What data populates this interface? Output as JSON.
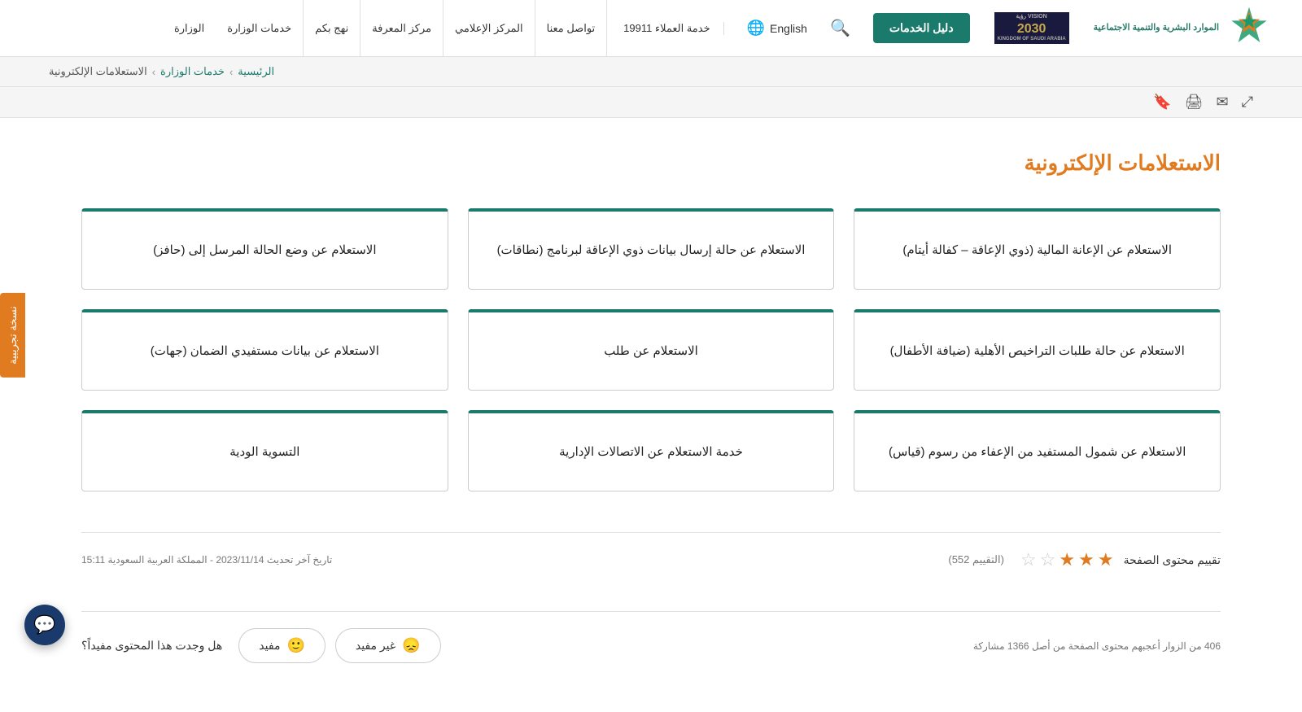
{
  "header": {
    "logo_text": "الموارد البشرية\nوالتنمية الاجتماعية",
    "services_btn_label": "دليل الخدمات",
    "lang_label": "English",
    "customer_service_label": "خدمة العملاء 19911",
    "nav_items": [
      {
        "label": "تواصل معنا"
      },
      {
        "label": "المركز الإعلامي"
      },
      {
        "label": "مركز المعرفة"
      },
      {
        "label": "نهج بكم"
      },
      {
        "label": "خدمات الوزارة"
      },
      {
        "label": "الوزارة"
      }
    ]
  },
  "breadcrumb": {
    "items": [
      {
        "label": "الرئيسية"
      },
      {
        "label": "خدمات الوزارة"
      },
      {
        "label": "الاستعلامات الإلكترونية"
      }
    ]
  },
  "toolbar": {
    "icons": [
      "share",
      "email",
      "print",
      "bookmark"
    ]
  },
  "side_tab": {
    "label": "نسخة تجريبية"
  },
  "page": {
    "title": "الاستعلامات الإلكترونية"
  },
  "cards": [
    {
      "text": "الاستعلام عن الإعانة المالية (ذوي الإعاقة – كفالة أيتام)"
    },
    {
      "text": "الاستعلام عن حالة إرسال بيانات ذوي الإعاقة لبرنامج (نطاقات)"
    },
    {
      "text": "الاستعلام عن وضع الحالة المرسل إلى (حافز)"
    },
    {
      "text": "الاستعلام عن حالة طلبات التراخيص الأهلية (ضيافة الأطفال)"
    },
    {
      "text": "الاستعلام عن طلب"
    },
    {
      "text": "الاستعلام عن بيانات مستفيدي الضمان (جهات)"
    },
    {
      "text": "الاستعلام عن شمول المستفيد من الإعفاء من رسوم (قياس)"
    },
    {
      "text": "خدمة الاستعلام عن الاتصالات الإدارية"
    },
    {
      "text": "التسوية الودية"
    }
  ],
  "rating": {
    "label": "تقييم محتوى الصفحة",
    "count_label": "(التقييم 552)",
    "stars": [
      1,
      1,
      1,
      0,
      0
    ],
    "update_text": "تاريخ آخر تحديث 2023/11/14 - المملكة العربية السعودية  15:11"
  },
  "feedback": {
    "question": "هل وجدت هذا المحتوى مفيداً؟",
    "btn_useful": "مفيد",
    "btn_not_useful": "غير مفيد",
    "visitors_text": "406 من الزوار أعجبهم محتوى الصفحة من أصل 1366 مشاركة"
  }
}
